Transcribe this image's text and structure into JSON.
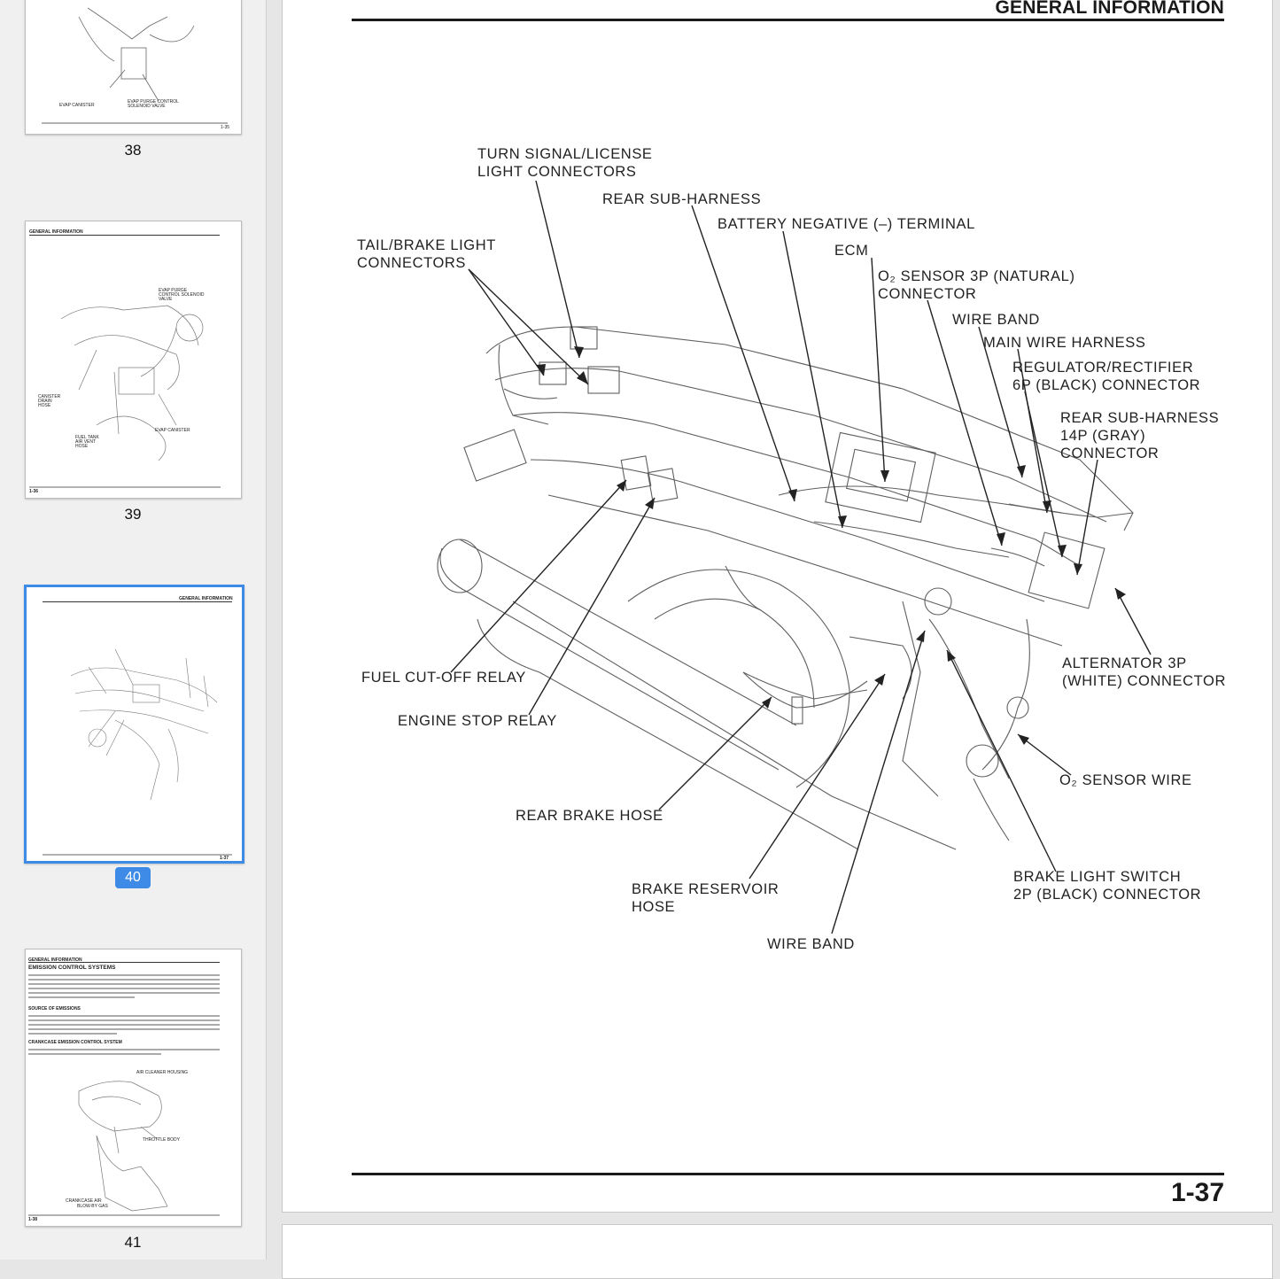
{
  "sidebar": {
    "thumbnails": [
      {
        "page": "38",
        "page_label": "1-35",
        "labels": [
          "EVAP CANISTER",
          "EVAP PURGE CONTROL SOLENOID VALVE"
        ]
      },
      {
        "page": "39",
        "page_label": "1-36",
        "header": "GENERAL INFORMATION",
        "labels": [
          "EVAP PURGE CONTROL SOLENOID VALVE",
          "CANISTER DRAIN HOSE",
          "EVAP CANISTER",
          "FUEL TANK AIR VENT HOSE"
        ]
      },
      {
        "page": "40",
        "page_label": "1-37",
        "header": "GENERAL INFORMATION",
        "selected": true
      },
      {
        "page": "41",
        "page_label": "1-38",
        "header": "GENERAL INFORMATION",
        "section_title": "EMISSION CONTROL SYSTEMS",
        "subheads": [
          "SOURCE OF EMISSIONS",
          "CRANKCASE EMISSION CONTROL SYSTEM"
        ],
        "labels": [
          "AIR CLEANER HOUSING",
          "THROTTLE BODY",
          "CRANKCASE AIR",
          "BLOW-BY GAS"
        ]
      }
    ]
  },
  "page": {
    "header": "GENERAL INFORMATION",
    "page_number": "1-37",
    "labels": {
      "turn_signal": "TURN SIGNAL/LICENSE\nLIGHT CONNECTORS",
      "rear_sub_harness": "REAR SUB-HARNESS",
      "battery_neg": "BATTERY NEGATIVE (–) TERMINAL",
      "tail_brake": "TAIL/BRAKE LIGHT\nCONNECTORS",
      "ecm": "ECM",
      "o2_sensor_conn": "O₂ SENSOR 3P (NATURAL)\nCONNECTOR",
      "wire_band_top": "WIRE BAND",
      "main_wire_harness": "MAIN WIRE HARNESS",
      "regulator": "REGULATOR/RECTIFIER\n6P (BLACK) CONNECTOR",
      "rear_sub_harness_14p": "REAR SUB-HARNESS\n14P (GRAY)\nCONNECTOR",
      "alternator": "ALTERNATOR 3P\n(WHITE) CONNECTOR",
      "fuel_cutoff": "FUEL CUT-OFF RELAY",
      "engine_stop": "ENGINE STOP RELAY",
      "o2_wire": "O₂ SENSOR WIRE",
      "rear_brake_hose": "REAR BRAKE HOSE",
      "brake_reservoir": "BRAKE RESERVOIR\nHOSE",
      "brake_light_switch": "BRAKE LIGHT SWITCH\n2P (BLACK) CONNECTOR",
      "wire_band_bottom": "WIRE BAND"
    }
  }
}
